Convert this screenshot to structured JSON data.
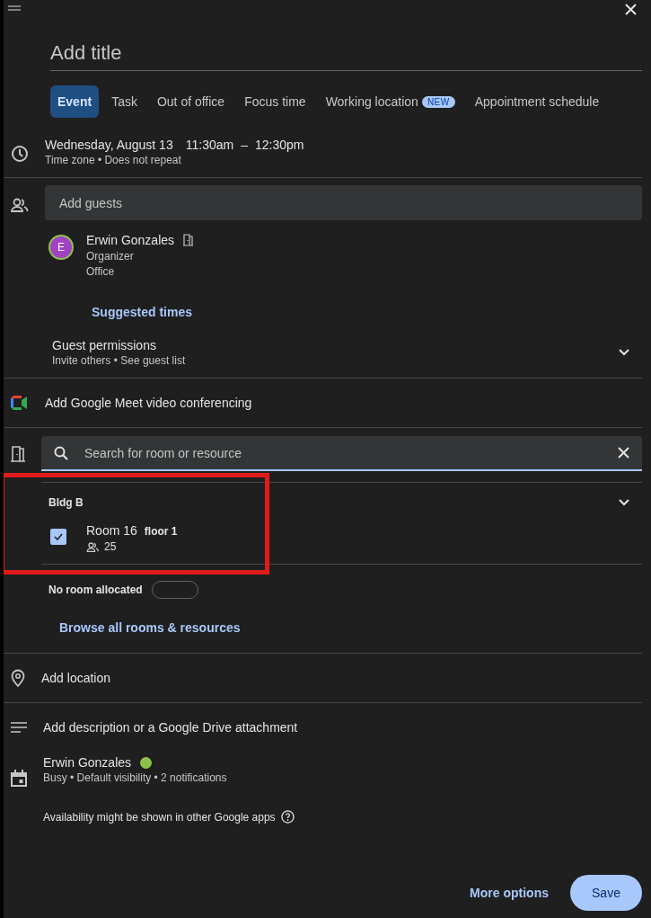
{
  "title_field": {
    "placeholder": "Add title"
  },
  "tabs": [
    {
      "label": "Event",
      "selected": true
    },
    {
      "label": "Task",
      "selected": false
    },
    {
      "label": "Out of office",
      "selected": false
    },
    {
      "label": "Focus time",
      "selected": false
    },
    {
      "label": "Working location",
      "selected": false,
      "badge": "NEW"
    },
    {
      "label": "Appointment schedule",
      "selected": false
    }
  ],
  "when": {
    "date": "Wednesday, August 13",
    "start": "11:30am",
    "dash": "–",
    "end": "12:30pm",
    "details": "Time zone • Does not repeat"
  },
  "guests": {
    "placeholder": "Add guests",
    "list": [
      {
        "initial": "E",
        "name": "Erwin Gonzales",
        "role": "Organizer",
        "location": "Office",
        "color": "#a142c4"
      }
    ],
    "suggested": "Suggested times",
    "permissions_title": "Guest permissions",
    "permissions_details": "Invite others • See guest list",
    "expanded": false
  },
  "conferencing": "Add Google Meet video conferencing",
  "rooms": {
    "placeholder": "Search for room or resource",
    "groups": [
      {
        "name": "Bldg B",
        "highlighted": true,
        "expanded": true,
        "rooms": [
          {
            "name": "Room 16",
            "floor": "floor 1",
            "capacity": "25",
            "checked": true
          }
        ]
      }
    ],
    "notice": "No room allocated",
    "browse": "Browse all rooms & resources"
  },
  "location": "Add location",
  "description": "Add description or a Google Drive attachment",
  "calendar": {
    "owner": "Erwin Gonzales",
    "color": "#8bc34a",
    "details": "Busy • Default visibility • 2 notifications",
    "availability": "Availability might be shown in other Google apps"
  },
  "buttons": {
    "more": "More options",
    "save": "Save"
  }
}
